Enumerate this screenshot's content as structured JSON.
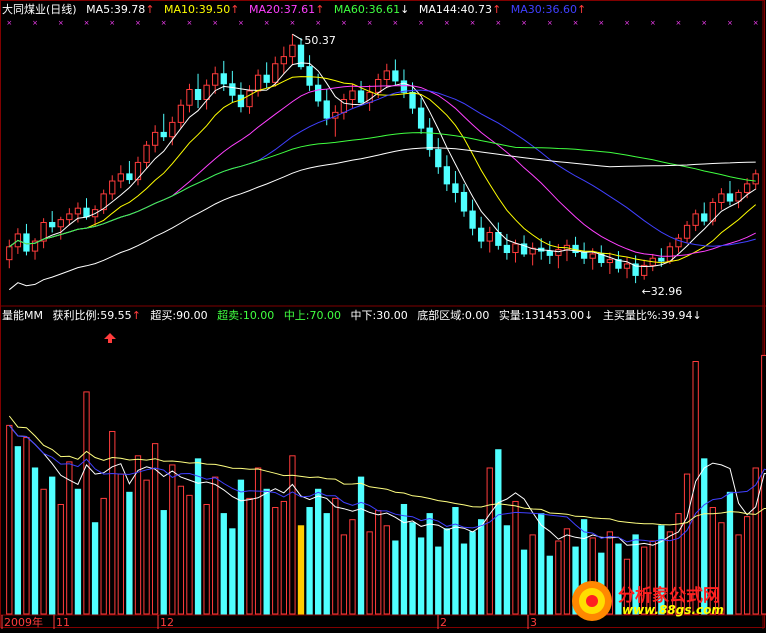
{
  "top_header": {
    "title": "大同煤业(日线)",
    "ma5": "MA5:39.78",
    "ma10": "MA10:39.50",
    "ma20": "MA20:37.61",
    "ma60": "MA60:36.61",
    "ma144": "MA144:40.73",
    "ma30": "MA30:36.60",
    "up_arrow": "↑",
    "down_arrow": "↓"
  },
  "bottom_header": {
    "indicator": "量能MM",
    "profit_ratio": "获利比例:59.55",
    "overbought": "超买:90.00",
    "oversold": "超卖:10.00",
    "mid_upper": "中上:70.00",
    "mid_lower": "中下:30.00",
    "bottom_zone": "底部区域:0.00",
    "real_volume": "实量:131453.00",
    "main_buy_ratio": "主买量比%:39.94"
  },
  "x_axis": {
    "labels": [
      "2009年",
      "11",
      "12",
      "2",
      "3"
    ]
  },
  "annotations": {
    "high": "50.37",
    "low": "32.96"
  },
  "watermark": {
    "name": "分析家公式网",
    "url": "www.88gs.com"
  },
  "colors": {
    "up": "#ff3c3c",
    "down": "#50ffff",
    "ma5": "#ffffff",
    "ma10": "#ffff00",
    "ma20": "#ff40ff",
    "ma60": "#40ff40",
    "ma144": "#ffffff",
    "ma30": "#4040ff",
    "grid": "#800000"
  },
  "chart_data": [
    {
      "type": "candlestick",
      "name": "price",
      "title": "大同煤业(日线)",
      "ohlc": [
        [
          34.6,
          36.0,
          34.0,
          35.5
        ],
        [
          35.5,
          36.8,
          35.0,
          36.4
        ],
        [
          36.4,
          37.1,
          34.9,
          35.2
        ],
        [
          35.2,
          36.1,
          34.6,
          35.9
        ],
        [
          35.9,
          37.5,
          35.4,
          37.2
        ],
        [
          37.2,
          38.0,
          36.5,
          36.9
        ],
        [
          36.9,
          37.6,
          36.0,
          37.4
        ],
        [
          37.4,
          38.2,
          37.0,
          37.8
        ],
        [
          37.8,
          38.6,
          37.2,
          38.2
        ],
        [
          38.2,
          38.9,
          37.4,
          37.6
        ],
        [
          37.6,
          38.4,
          36.9,
          38.1
        ],
        [
          38.1,
          39.5,
          37.8,
          39.2
        ],
        [
          39.2,
          40.5,
          38.8,
          40.1
        ],
        [
          40.1,
          41.2,
          39.6,
          40.6
        ],
        [
          40.6,
          41.5,
          39.9,
          40.2
        ],
        [
          40.2,
          41.8,
          39.8,
          41.4
        ],
        [
          41.4,
          42.9,
          41.0,
          42.6
        ],
        [
          42.6,
          44.0,
          42.1,
          43.5
        ],
        [
          43.5,
          44.8,
          42.9,
          43.2
        ],
        [
          43.2,
          44.6,
          42.6,
          44.2
        ],
        [
          44.2,
          45.8,
          43.8,
          45.4
        ],
        [
          45.4,
          46.9,
          44.9,
          46.5
        ],
        [
          46.5,
          47.6,
          45.2,
          45.8
        ],
        [
          45.8,
          47.2,
          45.1,
          46.8
        ],
        [
          46.8,
          48.1,
          46.2,
          47.6
        ],
        [
          47.6,
          48.5,
          46.4,
          46.9
        ],
        [
          46.9,
          47.8,
          45.6,
          46.1
        ],
        [
          46.1,
          47.0,
          44.9,
          45.3
        ],
        [
          45.3,
          46.8,
          44.8,
          46.4
        ],
        [
          46.4,
          47.9,
          46.0,
          47.5
        ],
        [
          47.5,
          48.4,
          46.6,
          47.0
        ],
        [
          47.0,
          48.8,
          46.7,
          48.3
        ],
        [
          48.3,
          49.5,
          47.6,
          48.8
        ],
        [
          48.8,
          50.37,
          48.2,
          49.6
        ],
        [
          49.6,
          50.1,
          47.9,
          48.1
        ],
        [
          48.1,
          48.9,
          46.4,
          46.8
        ],
        [
          46.8,
          47.6,
          45.3,
          45.7
        ],
        [
          45.7,
          46.5,
          44.0,
          44.5
        ],
        [
          44.5,
          45.4,
          43.2,
          44.9
        ],
        [
          44.9,
          46.2,
          44.4,
          45.8
        ],
        [
          45.8,
          46.9,
          45.2,
          46.4
        ],
        [
          46.4,
          47.1,
          45.4,
          45.6
        ],
        [
          45.6,
          46.8,
          45.0,
          46.3
        ],
        [
          46.3,
          47.6,
          45.9,
          47.2
        ],
        [
          47.2,
          48.3,
          46.6,
          47.8
        ],
        [
          47.8,
          48.6,
          46.8,
          47.1
        ],
        [
          47.1,
          47.9,
          45.9,
          46.3
        ],
        [
          46.3,
          47.0,
          44.8,
          45.2
        ],
        [
          45.2,
          45.9,
          43.4,
          43.8
        ],
        [
          43.8,
          44.5,
          41.8,
          42.3
        ],
        [
          42.3,
          43.1,
          40.6,
          41.1
        ],
        [
          41.1,
          41.9,
          39.4,
          39.9
        ],
        [
          39.9,
          40.8,
          38.6,
          39.3
        ],
        [
          39.3,
          39.9,
          37.6,
          38.0
        ],
        [
          38.0,
          38.8,
          36.3,
          36.8
        ],
        [
          36.8,
          37.6,
          35.4,
          35.9
        ],
        [
          35.9,
          36.9,
          35.1,
          36.5
        ],
        [
          36.5,
          37.2,
          35.3,
          35.6
        ],
        [
          35.6,
          36.4,
          34.6,
          35.1
        ],
        [
          35.1,
          36.0,
          34.4,
          35.7
        ],
        [
          35.7,
          36.3,
          34.8,
          35.0
        ],
        [
          35.0,
          35.8,
          34.2,
          35.4
        ],
        [
          35.4,
          36.1,
          34.6,
          35.2
        ],
        [
          35.2,
          35.9,
          34.3,
          34.9
        ],
        [
          34.9,
          35.7,
          34.0,
          35.3
        ],
        [
          35.3,
          36.0,
          34.5,
          35.6
        ],
        [
          35.6,
          36.2,
          34.8,
          35.1
        ],
        [
          35.1,
          35.8,
          34.3,
          34.7
        ],
        [
          34.7,
          35.4,
          33.9,
          35.0
        ],
        [
          35.0,
          35.6,
          34.1,
          34.4
        ],
        [
          34.4,
          35.1,
          33.6,
          34.6
        ],
        [
          34.6,
          35.2,
          33.7,
          34.0
        ],
        [
          34.0,
          34.8,
          33.3,
          34.3
        ],
        [
          34.3,
          34.9,
          32.96,
          33.5
        ],
        [
          33.5,
          34.6,
          33.2,
          34.2
        ],
        [
          34.2,
          35.0,
          33.8,
          34.7
        ],
        [
          34.7,
          35.4,
          34.1,
          34.5
        ],
        [
          34.5,
          35.8,
          34.3,
          35.5
        ],
        [
          35.5,
          36.4,
          35.1,
          36.1
        ],
        [
          36.1,
          37.3,
          35.8,
          37.0
        ],
        [
          37.0,
          38.1,
          36.6,
          37.8
        ],
        [
          37.8,
          38.6,
          37.0,
          37.3
        ],
        [
          37.3,
          38.9,
          37.0,
          38.6
        ],
        [
          38.6,
          39.6,
          38.1,
          39.2
        ],
        [
          39.2,
          40.1,
          38.4,
          38.7
        ],
        [
          38.7,
          39.5,
          38.2,
          39.3
        ],
        [
          39.3,
          40.3,
          38.9,
          39.9
        ],
        [
          39.9,
          40.9,
          39.5,
          40.6
        ]
      ],
      "annotations": [
        {
          "text": "50.37",
          "index": 33,
          "price": 50.37
        },
        {
          "text": "32.96",
          "index": 73,
          "price": 32.96
        }
      ]
    },
    {
      "type": "bar",
      "name": "volume",
      "values": [
        62,
        55,
        58,
        48,
        41,
        45,
        36,
        50,
        41,
        73,
        30,
        38,
        60,
        46,
        40,
        52,
        44,
        56,
        34,
        49,
        42,
        39,
        51,
        36,
        45,
        33,
        28,
        44,
        38,
        48,
        41,
        35,
        37,
        52,
        29,
        35,
        41,
        33,
        38,
        26,
        31,
        45,
        27,
        34,
        29,
        24,
        36,
        30,
        25,
        33,
        22,
        28,
        35,
        23,
        27,
        31,
        48,
        54,
        29,
        37,
        21,
        26,
        33,
        19,
        24,
        28,
        22,
        31,
        25,
        20,
        27,
        23,
        18,
        26,
        22,
        24,
        29,
        27,
        33,
        46,
        83,
        51,
        35,
        30,
        40,
        26,
        32,
        48,
        85,
        39
      ],
      "up_flags": [
        1,
        0,
        1,
        0,
        1,
        0,
        1,
        1,
        0,
        1,
        0,
        1,
        1,
        1,
        0,
        1,
        1,
        1,
        0,
        1,
        1,
        1,
        0,
        1,
        1,
        0,
        0,
        0,
        1,
        1,
        0,
        1,
        1,
        1,
        0,
        0,
        0,
        0,
        1,
        1,
        1,
        0,
        1,
        1,
        1,
        0,
        0,
        0,
        0,
        0,
        0,
        0,
        0,
        0,
        0,
        0,
        1,
        0,
        0,
        1,
        0,
        1,
        0,
        0,
        1,
        1,
        0,
        0,
        1,
        0,
        1,
        0,
        1,
        0,
        1,
        1,
        0,
        1,
        1,
        1,
        1,
        0,
        1,
        1,
        0,
        1,
        1,
        1,
        1,
        1
      ],
      "overbought": 90.0,
      "oversold": 10.0,
      "mid_upper": 70.0,
      "mid_lower": 30.0
    }
  ]
}
